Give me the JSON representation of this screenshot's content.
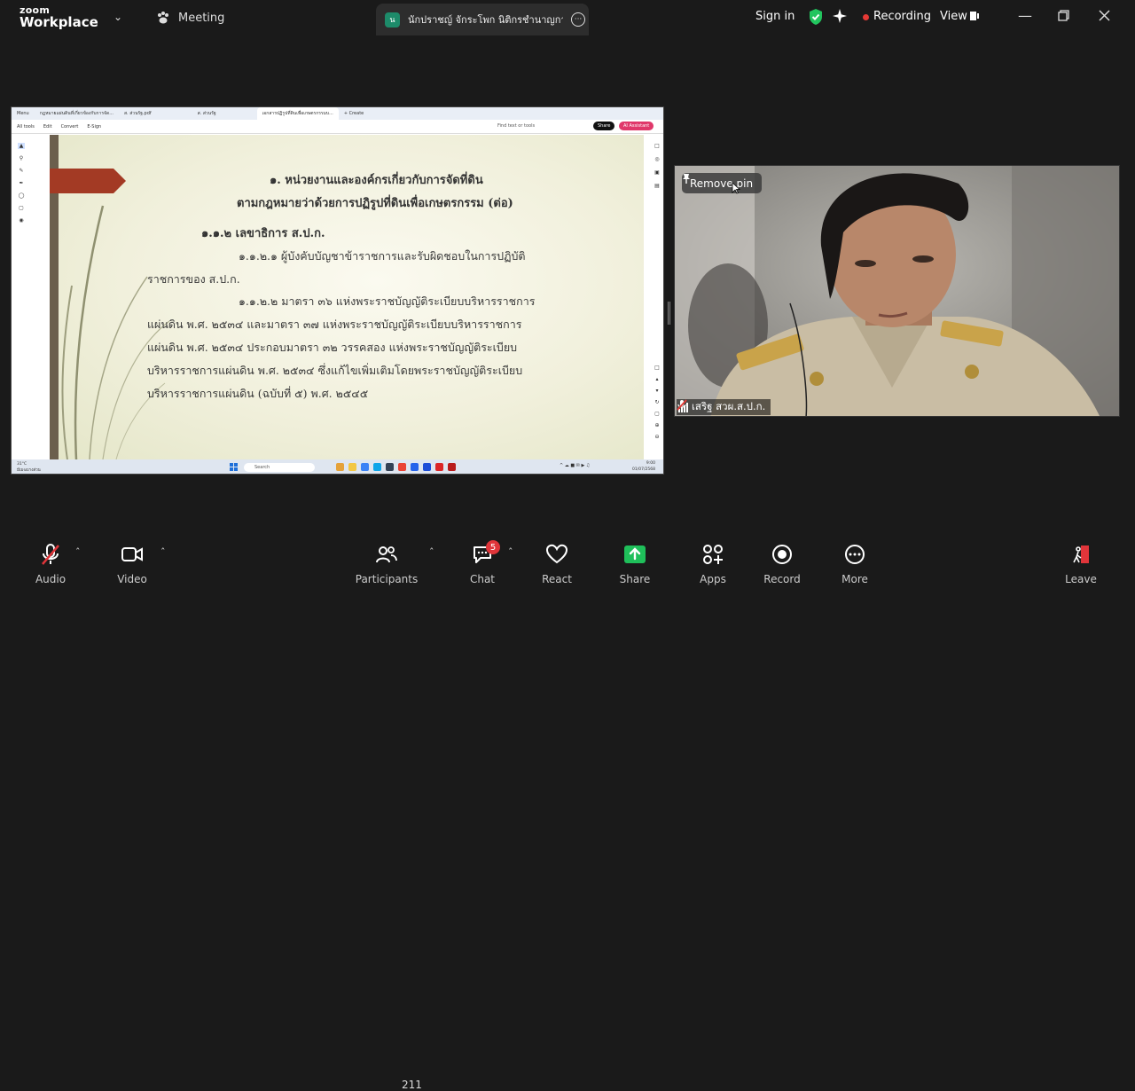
{
  "app": {
    "brand_small": "zoom",
    "brand_big": "Workplace"
  },
  "topbar": {
    "meeting_label": "Meeting",
    "active_tab": {
      "badge": "น",
      "title": "นักปราชญ์ จักระโพก นิติกรชำนาญการ"
    },
    "sign_in": "Sign in",
    "recording": "Recording",
    "view": "View"
  },
  "shared_screen": {
    "browser_tabs": [
      "Menu",
      "กฎหมายแผ่นดินที่เกี่ยวข้องกับการจัด...",
      "ส. ส่วนรัฐ.pdf",
      "ส. ส่วนรัฐ",
      "เอกสารปฏิรูปที่ดินเพื่อเกษตรกรรมบ...",
      "+ Create"
    ],
    "toolbar": [
      "All tools",
      "Edit",
      "Convert",
      "E-Sign"
    ],
    "find": "Find text or tools",
    "share_btn": "Share",
    "ai_btn": "AI Assistant",
    "slide": {
      "title_line1": "๑. หน่วยงานและองค์กรเกี่ยวกับการจัดที่ดิน",
      "title_line2": "ตามกฎหมายว่าด้วยการปฏิรูปที่ดินเพื่อเกษตรกรรม (ต่อ)",
      "heading": "๑.๑.๒ เลขาธิการ ส.ป.ก.",
      "lines": [
        "๑.๑.๒.๑ ผู้บังคับบัญชาข้าราชการและรับผิดชอบในการปฏิบัติ",
        "ราชการของ ส.ป.ก.",
        "๑.๑.๒.๒ มาตรา ๓๖ แห่งพระราชบัญญัติระเบียบบริหารราชการ",
        "แผ่นดิน พ.ศ. ๒๕๓๔ และมาตรา ๓๗ แห่งพระราชบัญญัติระเบียบบริหารราชการ",
        "แผ่นดิน พ.ศ. ๒๕๓๔ ประกอบมาตรา ๓๒ วรรคสอง แห่งพระราชบัญญัติระเบียบ",
        "บริหารราชการแผ่นดิน พ.ศ. ๒๕๓๔ ซึ่งแก้ไขเพิ่มเติมโดยพระราชบัญญัติระเบียบ",
        "บริหารราชการแผ่นดิน (ฉบับที่ ๕) พ.ศ. ๒๕๔๕"
      ]
    },
    "taskbar": {
      "weather_temp": "31°C",
      "weather_desc": "มีเมฆบางส่วน",
      "search": "Search",
      "time": "9:00",
      "date": "01/07/2568"
    }
  },
  "video": {
    "pin_label": "Remove pin",
    "participant_name": "เสริฐ สวผ.ส.ป.ก."
  },
  "controls": {
    "audio": "Audio",
    "video": "Video",
    "participants": "Participants",
    "participant_count": "211",
    "chat": "Chat",
    "chat_badge": "5",
    "react": "React",
    "share": "Share",
    "apps": "Apps",
    "record": "Record",
    "more": "More",
    "leave": "Leave"
  },
  "colors": {
    "share_green": "#1fbf5a",
    "recording_red": "#e53935",
    "leave_red": "#e0353a",
    "shield_green": "#22c55e"
  }
}
